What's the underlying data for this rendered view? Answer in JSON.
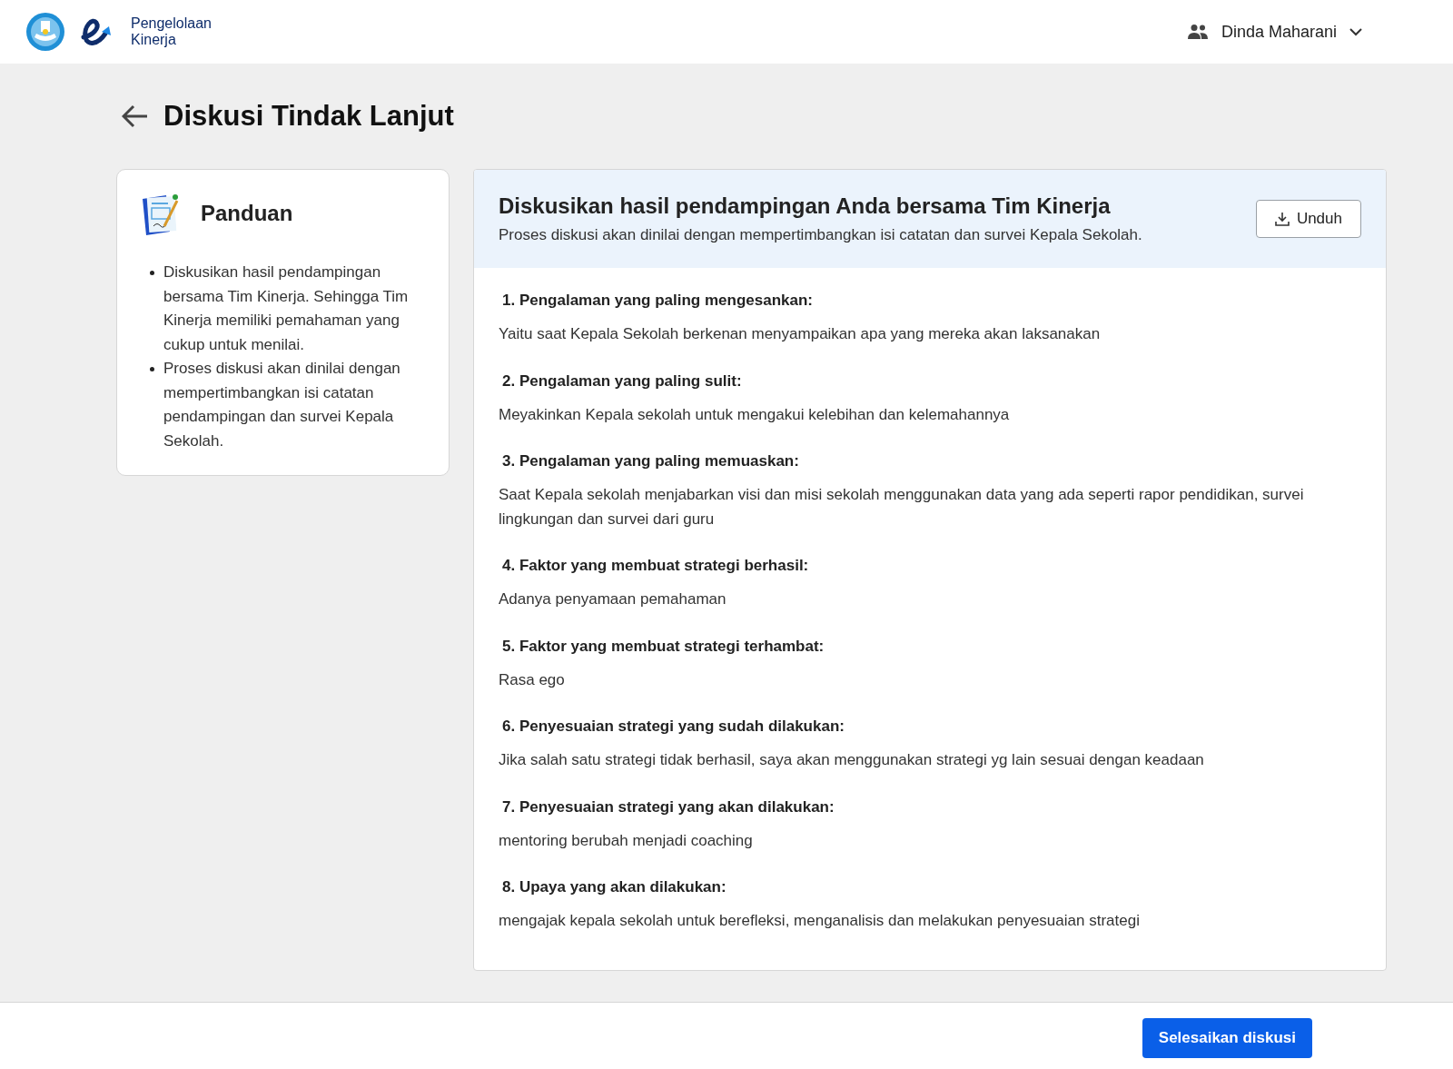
{
  "header": {
    "app_name_line1": "Pengelolaan",
    "app_name_line2": "Kinerja",
    "user": "Dinda Maharani"
  },
  "page": {
    "title": "Diskusi Tindak Lanjut"
  },
  "guide": {
    "title": "Panduan",
    "items": [
      "Diskusikan hasil pendampingan bersama Tim Kinerja. Sehingga Tim Kinerja memiliki pemahaman yang cukup untuk menilai.",
      "Proses diskusi akan dinilai dengan mempertimbangkan isi catatan pendampingan dan survei Kepala Sekolah."
    ]
  },
  "discussion": {
    "title": "Diskusikan hasil pendampingan Anda bersama Tim Kinerja",
    "subtitle": "Proses diskusi akan dinilai dengan mempertimbangkan isi catatan dan survei Kepala Sekolah.",
    "download_button": "Unduh",
    "questions": [
      {
        "question": "1. Pengalaman yang paling mengesankan:",
        "answer": "Yaitu saat Kepala Sekolah berkenan menyampaikan apa yang mereka akan laksanakan"
      },
      {
        "question": "2. Pengalaman yang paling sulit:",
        "answer": "Meyakinkan Kepala sekolah untuk mengakui kelebihan dan kelemahannya"
      },
      {
        "question": "3. Pengalaman yang paling memuaskan:",
        "answer": "Saat Kepala sekolah menjabarkan visi dan misi sekolah menggunakan data yang ada seperti rapor pendidikan, survei lingkungan dan survei dari guru"
      },
      {
        "question": "4. Faktor yang membuat strategi berhasil:",
        "answer": "Adanya penyamaan pemahaman"
      },
      {
        "question": "5. Faktor yang membuat strategi terhambat:",
        "answer": "Rasa ego"
      },
      {
        "question": "6. Penyesuaian strategi yang sudah dilakukan:",
        "answer": "Jika salah satu strategi tidak berhasil, saya akan menggunakan strategi yg lain sesuai dengan keadaan"
      },
      {
        "question": "7. Penyesuaian strategi yang akan dilakukan:",
        "answer": "mentoring berubah menjadi coaching"
      },
      {
        "question": "8. Upaya yang akan dilakukan:",
        "answer": "mengajak kepala sekolah untuk berefleksi, menganalisis dan melakukan penyesuaian strategi"
      }
    ]
  },
  "footer": {
    "primary_button": "Selesaikan diskusi"
  }
}
